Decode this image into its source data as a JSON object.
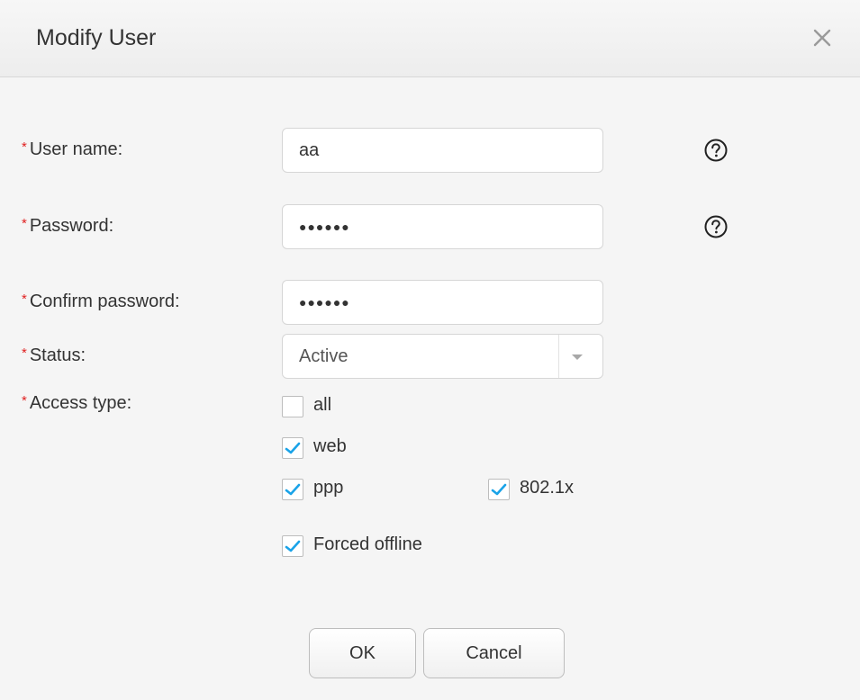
{
  "dialog": {
    "title": "Modify User",
    "close_icon": "close-icon"
  },
  "form": {
    "username": {
      "label": "User name:",
      "value": "aa",
      "required": "*",
      "help_icon": "question-circle-icon"
    },
    "password": {
      "label": "Password:",
      "value": "●●●●●●",
      "required": "*",
      "help_icon": "question-circle-icon"
    },
    "confirm_password": {
      "label": "Confirm password:",
      "value": "●●●●●●",
      "required": "*"
    },
    "status": {
      "label": "Status:",
      "value": "Active",
      "required": "*",
      "icon": "chevron-down-icon"
    },
    "access_type": {
      "label": "Access type:",
      "required": "*",
      "options": [
        {
          "label": "all",
          "checked": false
        },
        {
          "label": "web",
          "checked": true
        },
        {
          "label": "ppp",
          "checked": true
        },
        {
          "label": "802.1x",
          "checked": true
        }
      ]
    },
    "forced_offline": {
      "label": "Forced offline",
      "checked": true
    }
  },
  "buttons": {
    "ok_label": "OK",
    "cancel_label": "Cancel"
  },
  "colors": {
    "check_accent": "#1aa3e8",
    "required_mark": "#e02020",
    "background": "#f5f5f5"
  }
}
